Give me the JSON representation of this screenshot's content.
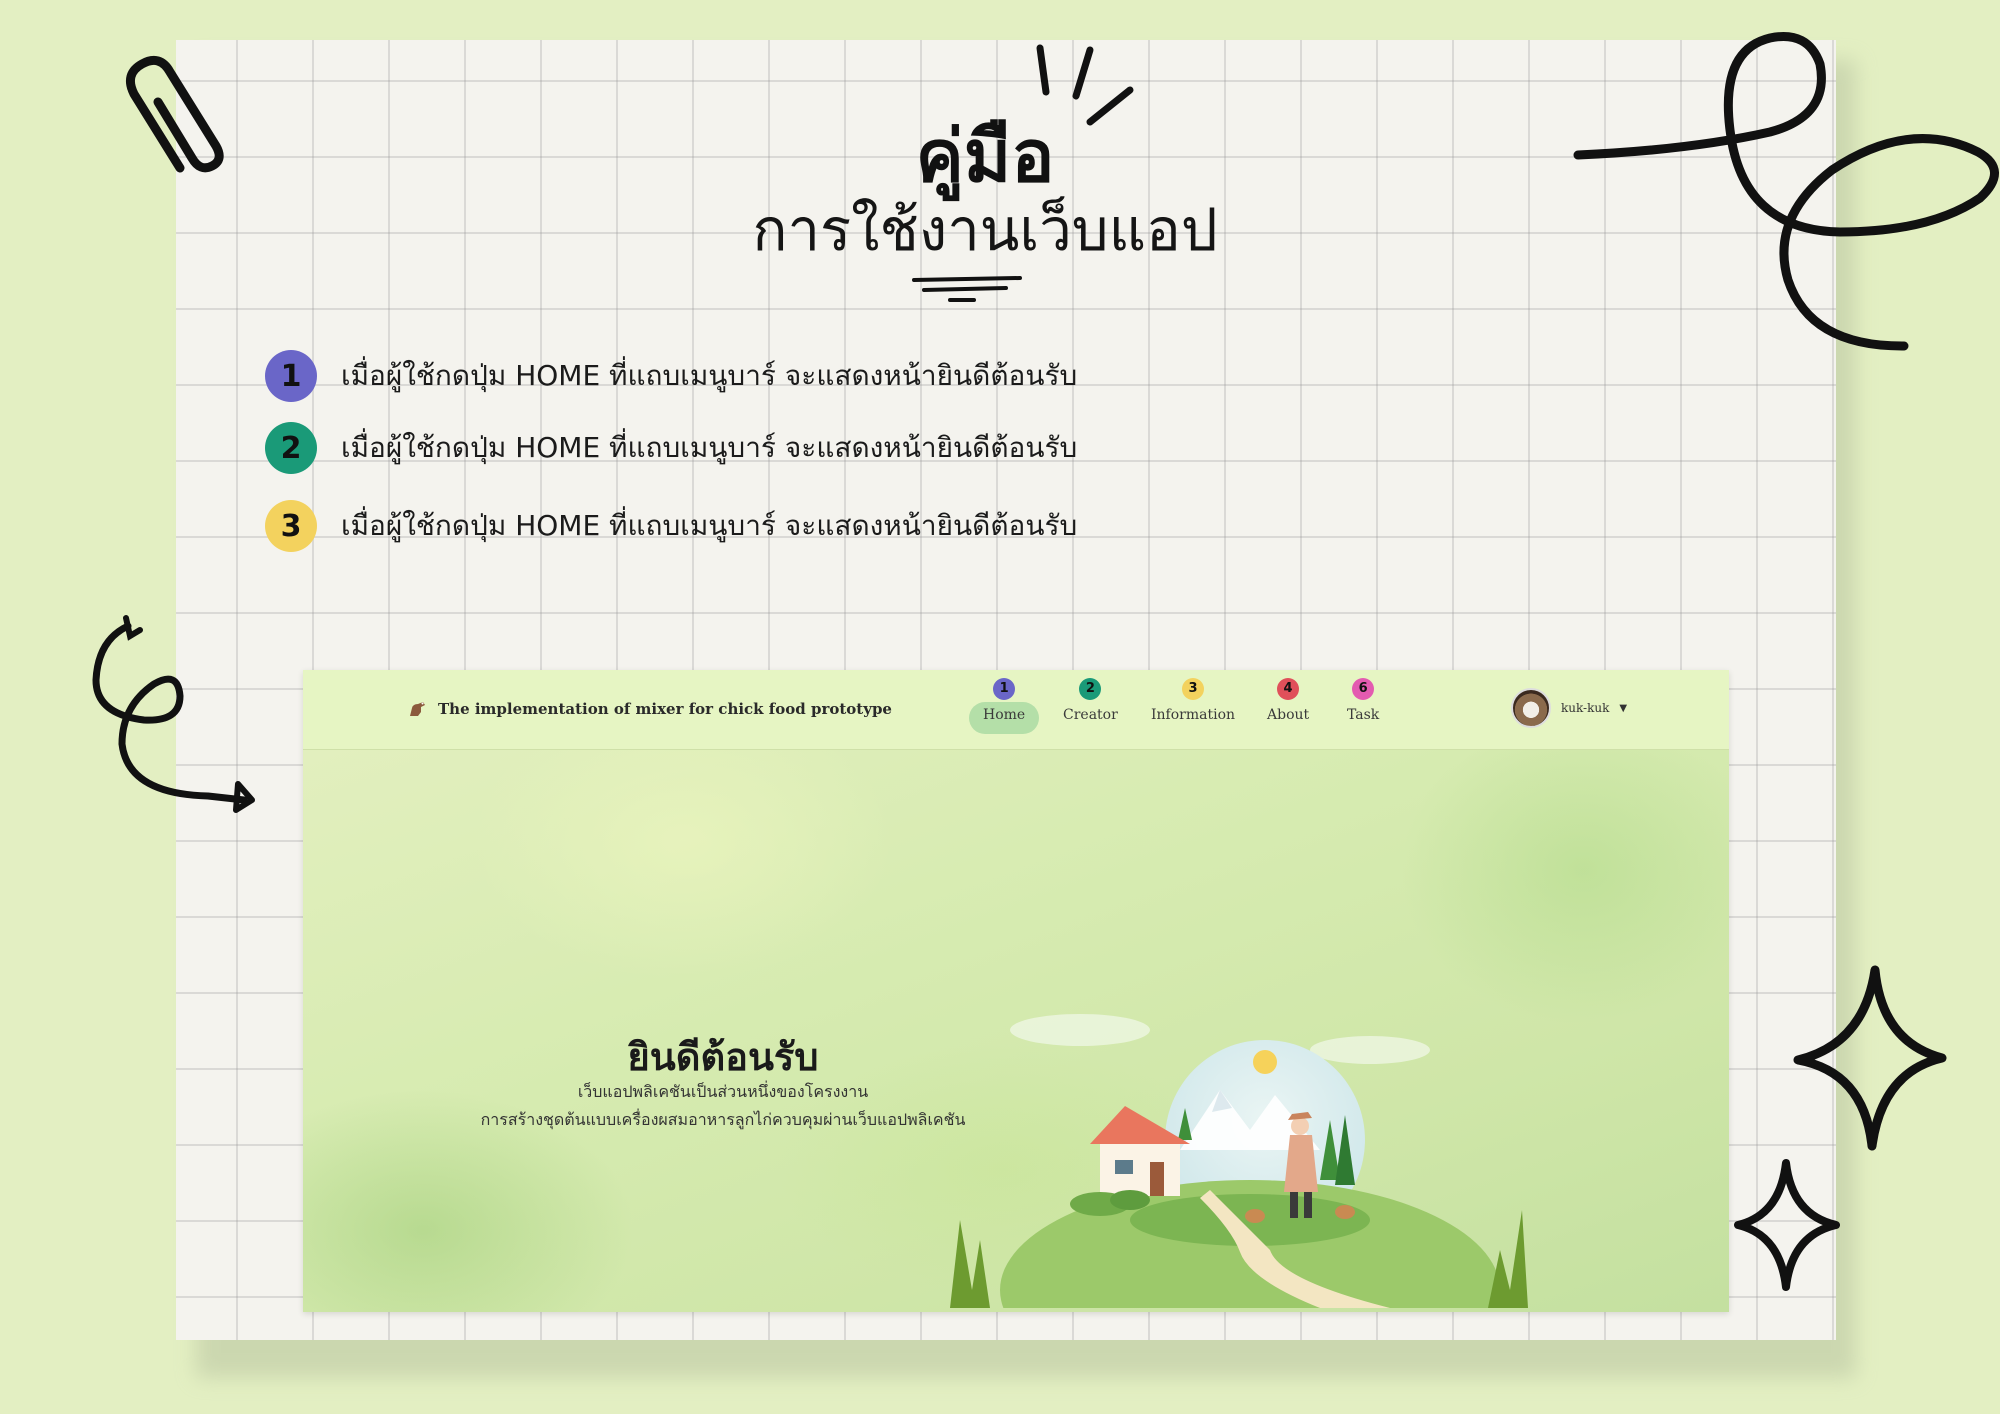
{
  "guide": {
    "title": "คู่มือ",
    "subtitle": "การใช้งานเว็บแอป"
  },
  "steps": [
    {
      "number": "1",
      "color": "#6a66c8",
      "text": "เมื่อผู้ใช้กดปุ่ม HOME ที่แถบเมนูบาร์ จะแสดงหน้ายินดีต้อนรับ"
    },
    {
      "number": "2",
      "color": "#1a9a78",
      "text": "เมื่อผู้ใช้กดปุ่ม HOME ที่แถบเมนูบาร์ จะแสดงหน้ายินดีต้อนรับ"
    },
    {
      "number": "3",
      "color": "#f3d25e",
      "text": "เมื่อผู้ใช้กดปุ่ม HOME ที่แถบเมนูบาร์ จะแสดงหน้ายินดีต้อนรับ"
    }
  ],
  "app": {
    "brand": "The implementation of mixer for chick food prototype",
    "nav": [
      {
        "badge": "1",
        "label": "Home",
        "color": "#6a66c8",
        "active": true
      },
      {
        "badge": "2",
        "label": "Creator",
        "color": "#1a9a78",
        "active": false
      },
      {
        "badge": "3",
        "label": "Information",
        "color": "#f3d25e",
        "active": false
      },
      {
        "badge": "4",
        "label": "About",
        "color": "#e0505a",
        "active": false
      },
      {
        "badge": "6",
        "label": "Task",
        "color": "#e35bb0",
        "active": false
      }
    ],
    "user": {
      "name": "kuk-kuk"
    },
    "hero": {
      "title": "ยินดีต้อนรับ",
      "line1": "เว็บแอปพลิเคชันเป็นส่วนหนึ่งของโครงงาน",
      "line2": "การสร้างชุดต้นแบบเครื่องผสมอาหารลูกไก่ควบคุมผ่านเว็บแอปพลิเคชัน"
    }
  },
  "icons": [
    "paperclip-icon",
    "sparkle-icon",
    "curly-arrow-icon",
    "scribble-loop-icon",
    "star-icon"
  ]
}
